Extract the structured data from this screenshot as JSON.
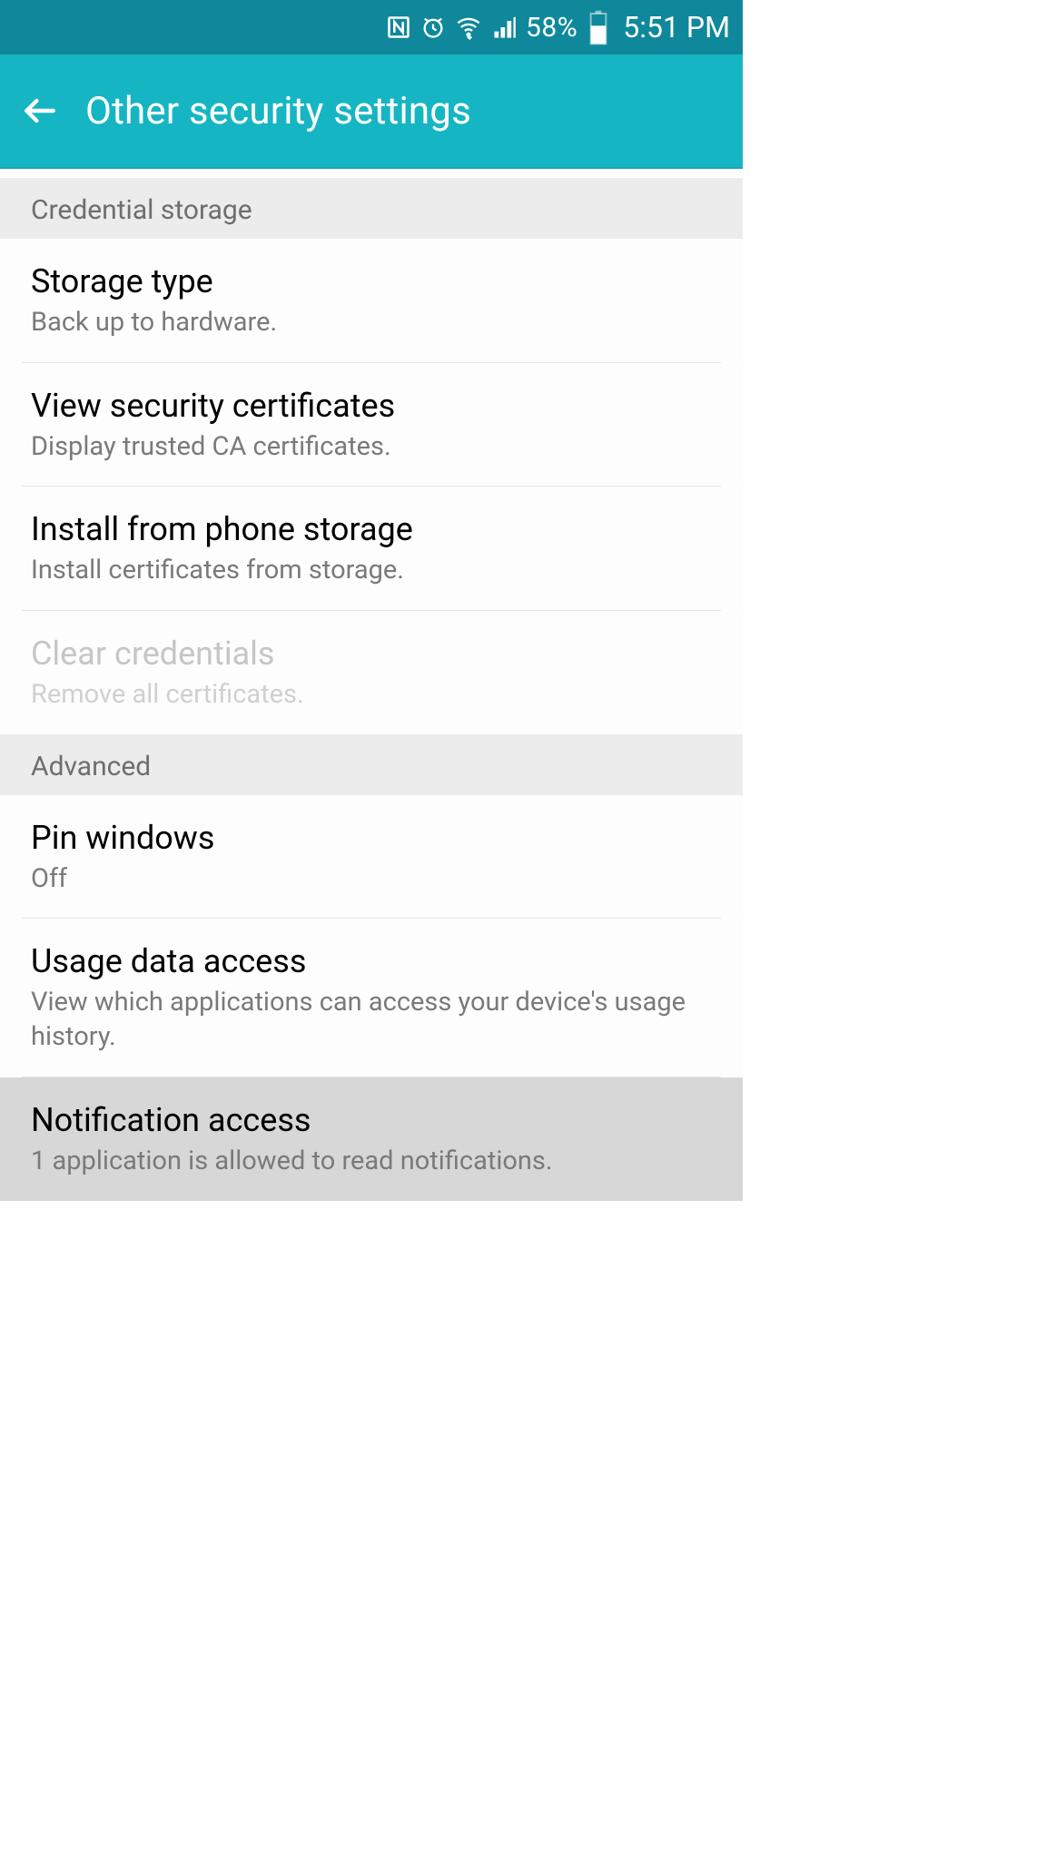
{
  "status": {
    "battery_pct": "58%",
    "clock": "5:51 PM"
  },
  "appbar": {
    "title": "Other security settings"
  },
  "sections": {
    "credential": {
      "header": "Credential storage",
      "storage_type": {
        "title": "Storage type",
        "sub": "Back up to hardware."
      },
      "view_certs": {
        "title": "View security certificates",
        "sub": "Display trusted CA certificates."
      },
      "install": {
        "title": "Install from phone storage",
        "sub": "Install certificates from storage."
      },
      "clear": {
        "title": "Clear credentials",
        "sub": "Remove all certificates."
      }
    },
    "advanced": {
      "header": "Advanced",
      "pin_windows": {
        "title": "Pin windows",
        "sub": "Off"
      },
      "usage": {
        "title": "Usage data access",
        "sub": "View which applications can access your device's usage history."
      },
      "notif": {
        "title": "Notification access",
        "sub": "1 application is allowed to read notifications."
      }
    }
  }
}
